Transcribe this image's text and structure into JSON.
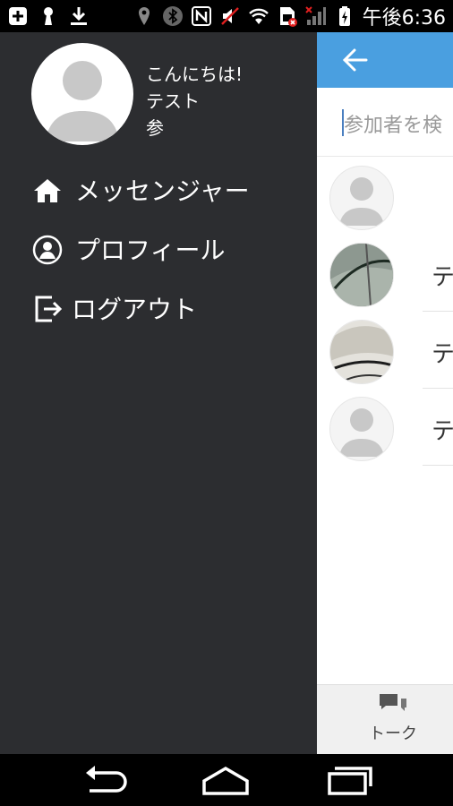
{
  "status_bar": {
    "time": "午後6:36",
    "icons": [
      "plus-icon",
      "keyhole-icon",
      "download-icon",
      "location-icon",
      "bluetooth-icon",
      "nfc-icon",
      "mute-icon",
      "wifi-icon",
      "sim-icon",
      "signal-icon",
      "battery-icon"
    ]
  },
  "app": {
    "search_placeholder": "参加者を検",
    "participants": [
      {
        "name": ""
      },
      {
        "name": "テ"
      },
      {
        "name": "テ"
      },
      {
        "name": "テ"
      }
    ],
    "tab_talk_label": "トーク"
  },
  "drawer": {
    "greeting_line1": "こんにちは!",
    "greeting_line2": "テスト",
    "greeting_line3": "参",
    "menu": [
      {
        "label": "メッセンジャー",
        "icon": "home-icon"
      },
      {
        "label": "プロフィール",
        "icon": "profile-icon"
      },
      {
        "label": "ログアウト",
        "icon": "logout-icon"
      }
    ]
  },
  "colors": {
    "drawer_bg": "#2c2d30",
    "appbar": "#4a9fe0"
  }
}
